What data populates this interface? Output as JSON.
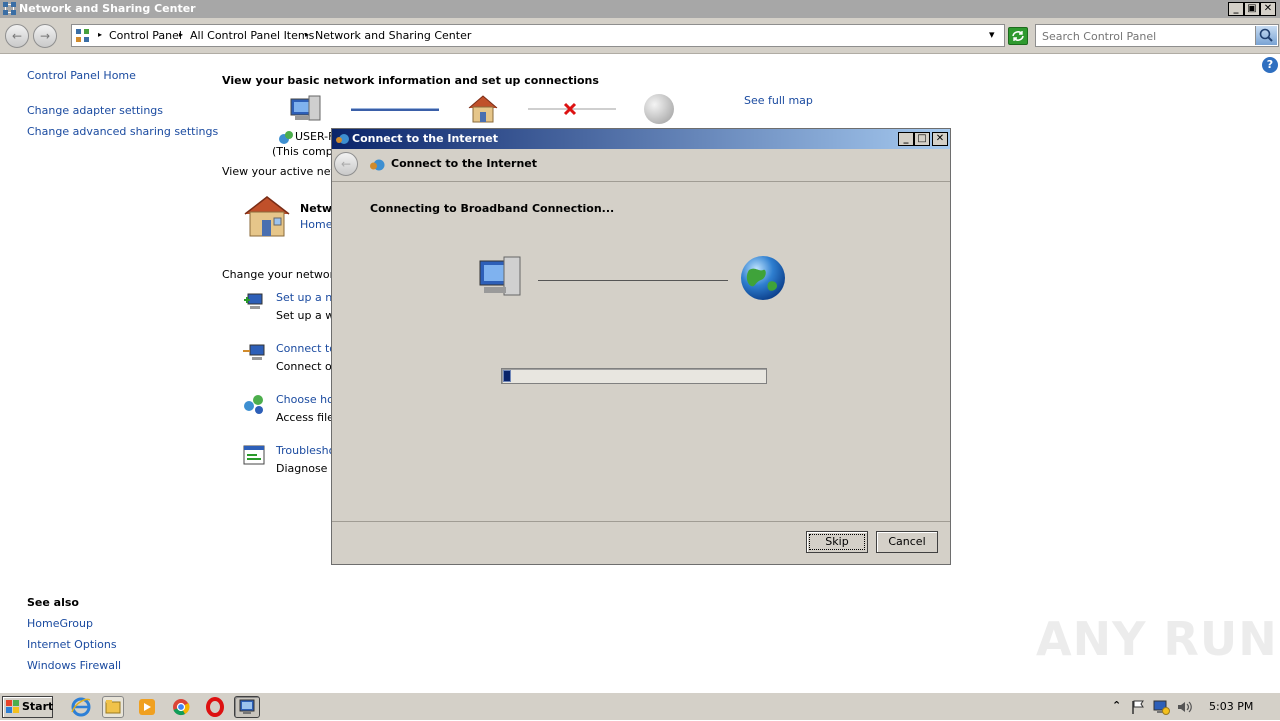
{
  "window": {
    "title": "Network and Sharing Center",
    "min": "_",
    "max": "▣",
    "close": "✕"
  },
  "nav": {
    "back": "←",
    "forward": "→"
  },
  "breadcrumb": {
    "items": [
      "Control Panel",
      "All Control Panel Items",
      "Network and Sharing Center"
    ],
    "sep": "▸",
    "dropdown": "▾"
  },
  "search": {
    "placeholder": "Search Control Panel"
  },
  "help": "?",
  "sidebar": {
    "home": "Control Panel Home",
    "links": [
      "Change adapter settings",
      "Change advanced sharing settings"
    ],
    "see_also_title": "See also",
    "see_also": [
      "HomeGroup",
      "Internet Options",
      "Windows Firewall"
    ]
  },
  "main": {
    "heading": "View your basic network information and set up connections",
    "see_full_map": "See full map",
    "computer_name": "USER-F",
    "computer_sub": "(This compu",
    "active_networks": "View your active netw",
    "network_name": "Netw",
    "network_type": "Home",
    "change_settings": "Change your networki",
    "tasks": [
      {
        "title": "Set up a ne",
        "desc": "Set up a wi"
      },
      {
        "title": "Connect to",
        "desc": "Connect or"
      },
      {
        "title": "Choose hor",
        "desc": "Access files"
      },
      {
        "title": "Troublesho",
        "desc": "Diagnose a"
      }
    ]
  },
  "dialog": {
    "title": "Connect to the Internet",
    "header": "Connect to the Internet",
    "status": "Connecting to Broadband Connection...",
    "progress": 0.03,
    "skip": "Skip",
    "cancel": "Cancel",
    "min": "_",
    "max": "□",
    "close": "✕"
  },
  "taskbar": {
    "start": "Start",
    "clock": "5:03 PM",
    "tray_chevron": "⌃"
  },
  "watermark": "ANY RUN",
  "colors": {
    "link": "#1b4ba0",
    "progress": "#0a246a",
    "dialog_bg": "#d4d0c8"
  }
}
